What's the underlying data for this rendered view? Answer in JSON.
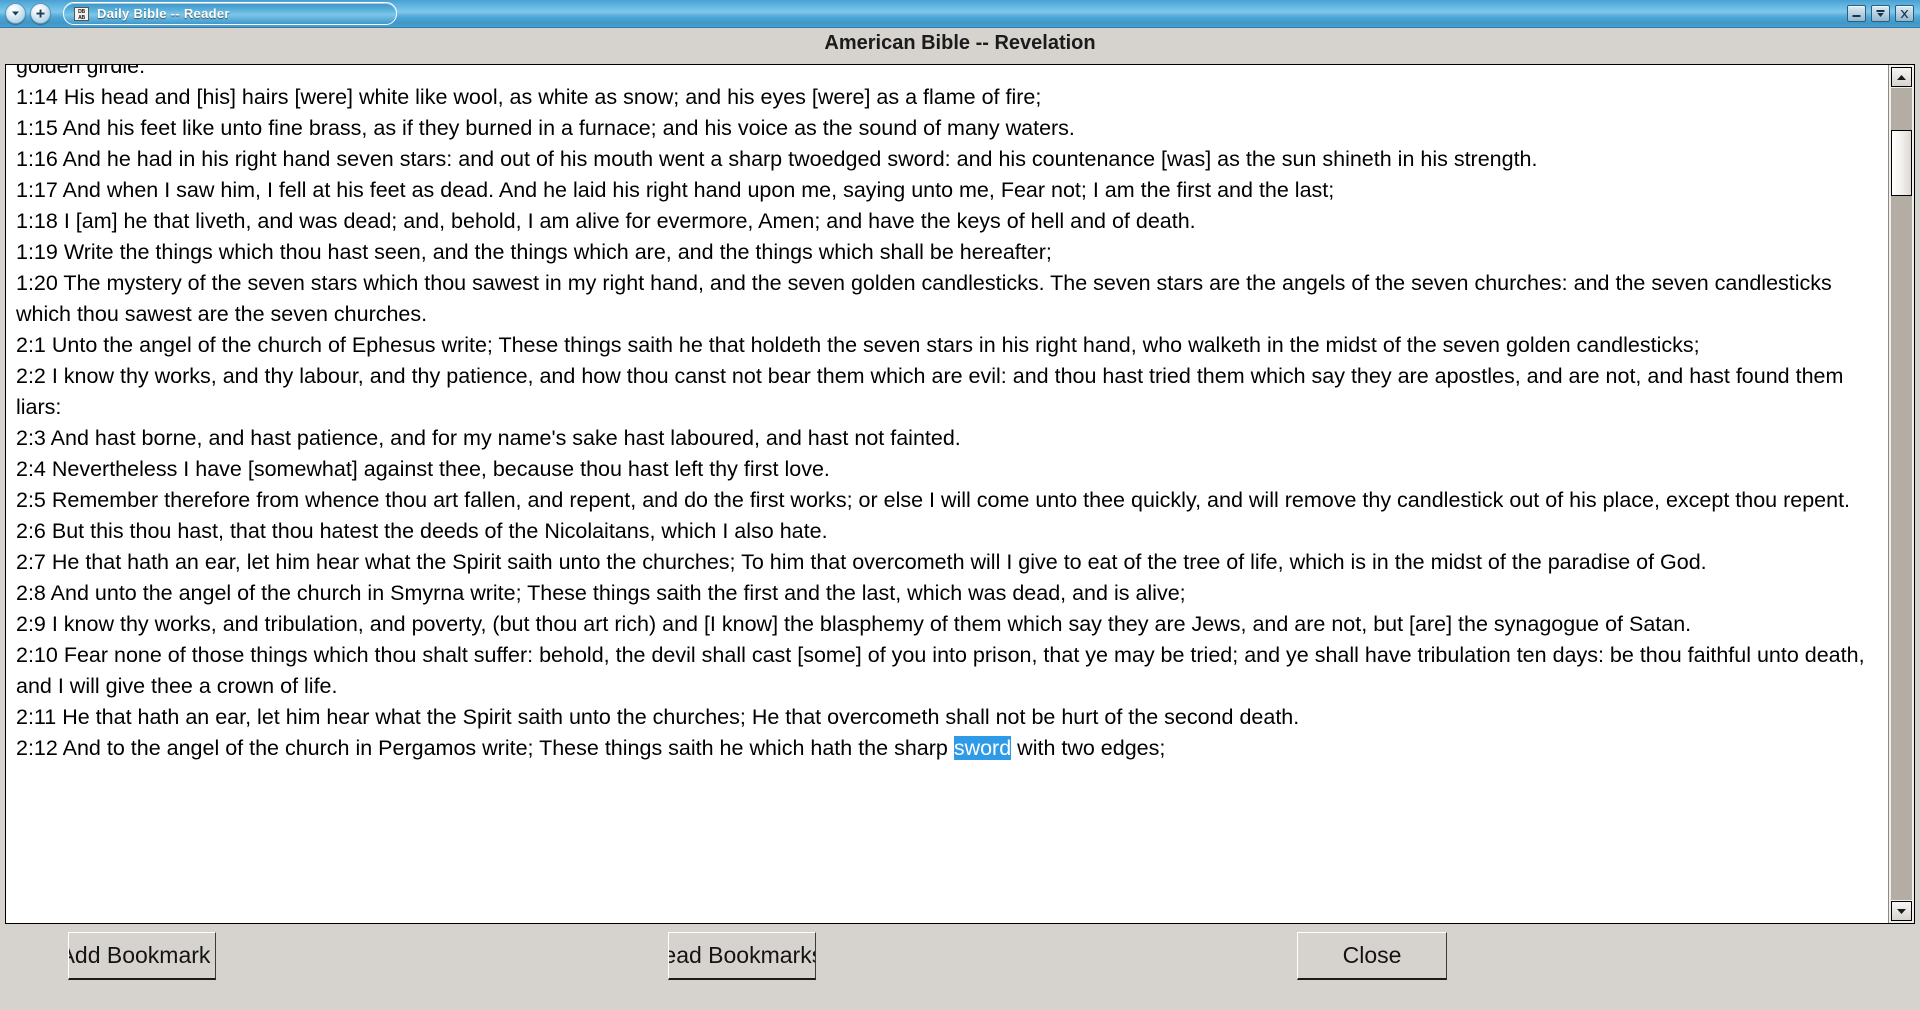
{
  "window": {
    "app_title": "Daily Bible -- Reader",
    "app_icon": "book-icon",
    "icon_glyph_line1": "DB",
    "icon_glyph_line2": "AB",
    "left_buttons": [
      {
        "name": "window-menu-button",
        "icon": "chevron-down-icon"
      },
      {
        "name": "window-add-button",
        "icon": "plus-icon"
      }
    ],
    "controls": [
      {
        "name": "minimize-button",
        "icon": "minimize-icon"
      },
      {
        "name": "restore-button",
        "icon": "restore-down-icon"
      },
      {
        "name": "close-window-button",
        "icon": "close-icon"
      }
    ],
    "titlebar_color": "#4a9fd0"
  },
  "header": {
    "title": "American Bible -- Revelation"
  },
  "reader": {
    "selection": {
      "text": "sword",
      "highlight_color": "#2e9ae8",
      "text_color": "#ffffff"
    },
    "verses": [
      {
        "ref": "",
        "text": "golden girdle."
      },
      {
        "ref": "1:14",
        "text": "1:14 His head and [his] hairs [were] white like wool, as white as snow; and his eyes [were] as a flame of fire;"
      },
      {
        "ref": "1:15",
        "text": "1:15 And his feet like unto fine brass, as if they burned in a furnace; and his voice as the sound of many waters."
      },
      {
        "ref": "1:16",
        "text": "1:16 And he had in his right hand seven stars: and out of his mouth went a sharp twoedged sword: and his countenance [was] as the sun shineth in his strength."
      },
      {
        "ref": "1:17",
        "text": "1:17 And when I saw him, I fell at his feet as dead. And he laid his right hand upon me, saying unto me, Fear not; I am the first and the last;"
      },
      {
        "ref": "1:18",
        "text": "1:18 I [am] he that liveth, and was dead; and, behold, I am alive for evermore, Amen; and have the keys of hell and of death."
      },
      {
        "ref": "1:19",
        "text": "1:19 Write the things which thou hast seen, and the things which are, and the things which shall be hereafter;"
      },
      {
        "ref": "1:20",
        "text": "1:20 The mystery of the seven stars which thou sawest in my right hand, and the seven golden candlesticks. The seven stars are the angels of the seven churches: and the seven candlesticks which thou sawest are the seven churches."
      },
      {
        "ref": "2:1",
        "text": "2:1 Unto the angel of the church of Ephesus write; These things saith he that holdeth the seven stars in his right hand, who walketh in the midst of the seven golden candlesticks;"
      },
      {
        "ref": "2:2",
        "text": "2:2 I know thy works, and thy labour, and thy patience, and how thou canst not bear them which are evil: and thou hast tried them which say they are apostles, and are not, and hast found them liars:"
      },
      {
        "ref": "2:3",
        "text": "2:3 And hast borne, and hast patience, and for my name's sake hast laboured, and hast not fainted."
      },
      {
        "ref": "2:4",
        "text": "2:4 Nevertheless I have [somewhat] against thee, because thou hast left thy first love."
      },
      {
        "ref": "2:5",
        "text": "2:5 Remember therefore from whence thou art fallen, and repent, and do the first works; or else I will come unto thee quickly, and will remove thy candlestick out of his place, except thou repent."
      },
      {
        "ref": "2:6",
        "text": "2:6 But this thou hast, that thou hatest the deeds of the Nicolaitans, which I also hate."
      },
      {
        "ref": "2:7",
        "text": "2:7 He that hath an ear, let him hear what the Spirit saith unto the churches; To him that overcometh will I give to eat of the tree of life, which is in the midst of the paradise of God."
      },
      {
        "ref": "2:8",
        "text": "2:8 And unto the angel of the church in Smyrna write; These things saith the first and the last, which was dead, and is alive;"
      },
      {
        "ref": "2:9",
        "text": "2:9 I know thy works, and tribulation, and poverty, (but thou art rich) and [I know] the blasphemy of them which say they are Jews, and are not, but [are] the synagogue of Satan."
      },
      {
        "ref": "2:10",
        "text": "2:10 Fear none of those things which thou shalt suffer: behold, the devil shall cast [some] of you into prison, that ye may be tried; and ye shall have tribulation ten days: be thou faithful unto death, and I will give thee a crown of life."
      },
      {
        "ref": "2:11",
        "text": "2:11 He that hath an ear, let him hear what the Spirit saith unto the churches; He that overcometh shall not be hurt of the second death."
      }
    ],
    "last_verse": {
      "before": "2:12 And to the angel of the church in Pergamos write; These things saith he which hath the sharp ",
      "selected": "sword",
      "after": " with two edges;"
    }
  },
  "scrollbar": {
    "up_icon": "scroll-up-arrow-icon",
    "down_icon": "scroll-down-arrow-icon"
  },
  "buttons": {
    "add_bookmark": "Add Bookmark",
    "read_bookmarks": "Read Bookmarks",
    "close": "Close"
  }
}
